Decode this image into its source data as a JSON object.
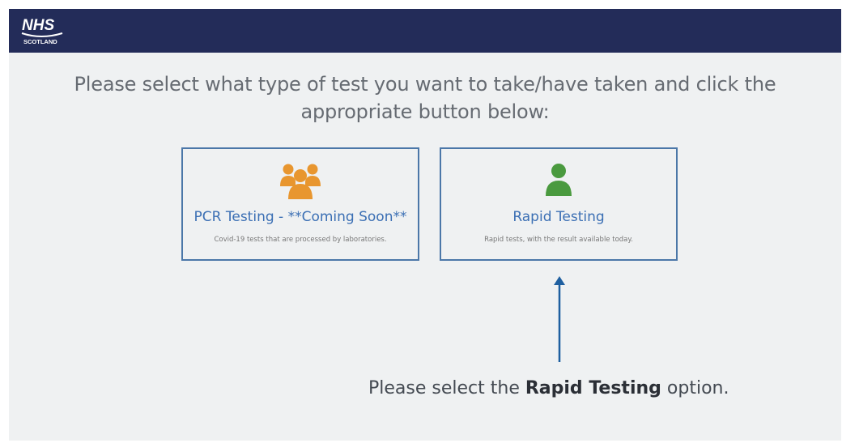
{
  "header": {
    "logo_top": "NHS",
    "logo_bottom": "SCOTLAND",
    "background": "#232c59"
  },
  "prompt": {
    "line1": "Please select what type of test you want to take/have taken and click the",
    "line2": "appropriate button below:"
  },
  "options": [
    {
      "title": "PCR Testing - **Coming Soon**",
      "description": "Covid-19 tests that are processed by laboratories.",
      "icon": "group-people-icon",
      "icon_color": "#e8962f"
    },
    {
      "title": "Rapid Testing",
      "description": "Rapid tests, with the result available today.",
      "icon": "person-icon",
      "icon_color": "#4a9a3f"
    }
  ],
  "instruction": {
    "prefix": "Please select the ",
    "emphasis": "Rapid Testing",
    "suffix": " option."
  },
  "colors": {
    "card_border": "#4b77a8",
    "link_blue": "#3b6fb4",
    "arrow": "#1e5fa0"
  }
}
